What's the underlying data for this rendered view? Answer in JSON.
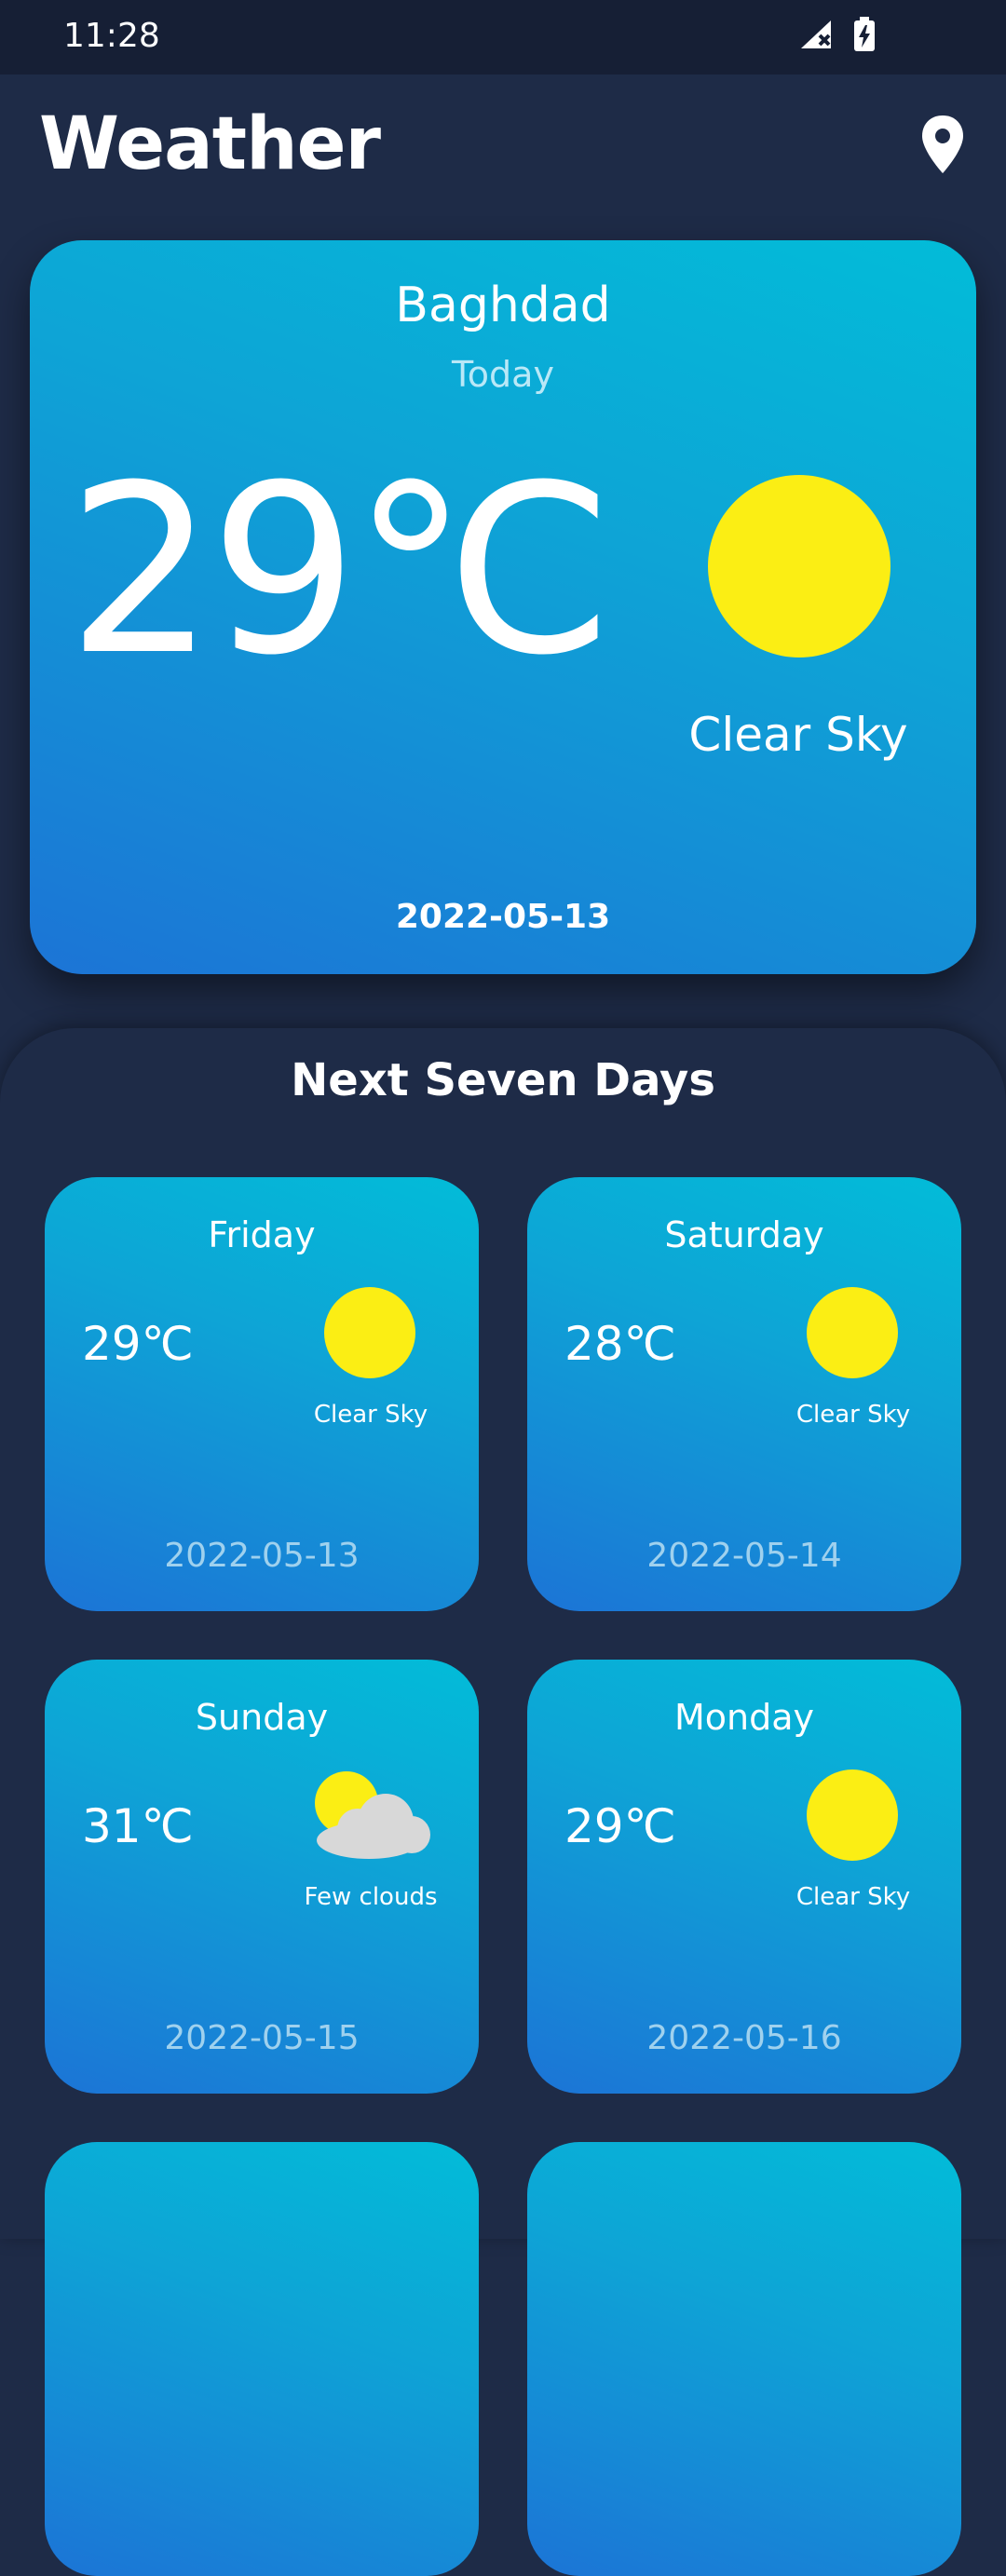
{
  "status_bar": {
    "time": "11:28"
  },
  "header": {
    "title": "Weather"
  },
  "today": {
    "city": "Baghdad",
    "day_label": "Today",
    "temperature": "29℃",
    "condition": "Clear Sky",
    "date": "2022-05-13",
    "icon": "sun-icon"
  },
  "forecast": {
    "title": "Next Seven Days",
    "days": [
      {
        "name": "Friday",
        "temp": "29℃",
        "condition": "Clear Sky",
        "date": "2022-05-13",
        "icon": "sun-icon"
      },
      {
        "name": "Saturday",
        "temp": "28℃",
        "condition": "Clear Sky",
        "date": "2022-05-14",
        "icon": "sun-icon"
      },
      {
        "name": "Sunday",
        "temp": "31℃",
        "condition": "Few clouds",
        "date": "2022-05-15",
        "icon": "sun-cloud-icon"
      },
      {
        "name": "Monday",
        "temp": "29℃",
        "condition": "Clear Sky",
        "date": "2022-05-16",
        "icon": "sun-icon"
      }
    ]
  },
  "colors": {
    "background": "#1e2b47",
    "card_gradient_start": "#1c74d6",
    "card_gradient_end": "#02bcd8",
    "sun": "#fbee14"
  }
}
